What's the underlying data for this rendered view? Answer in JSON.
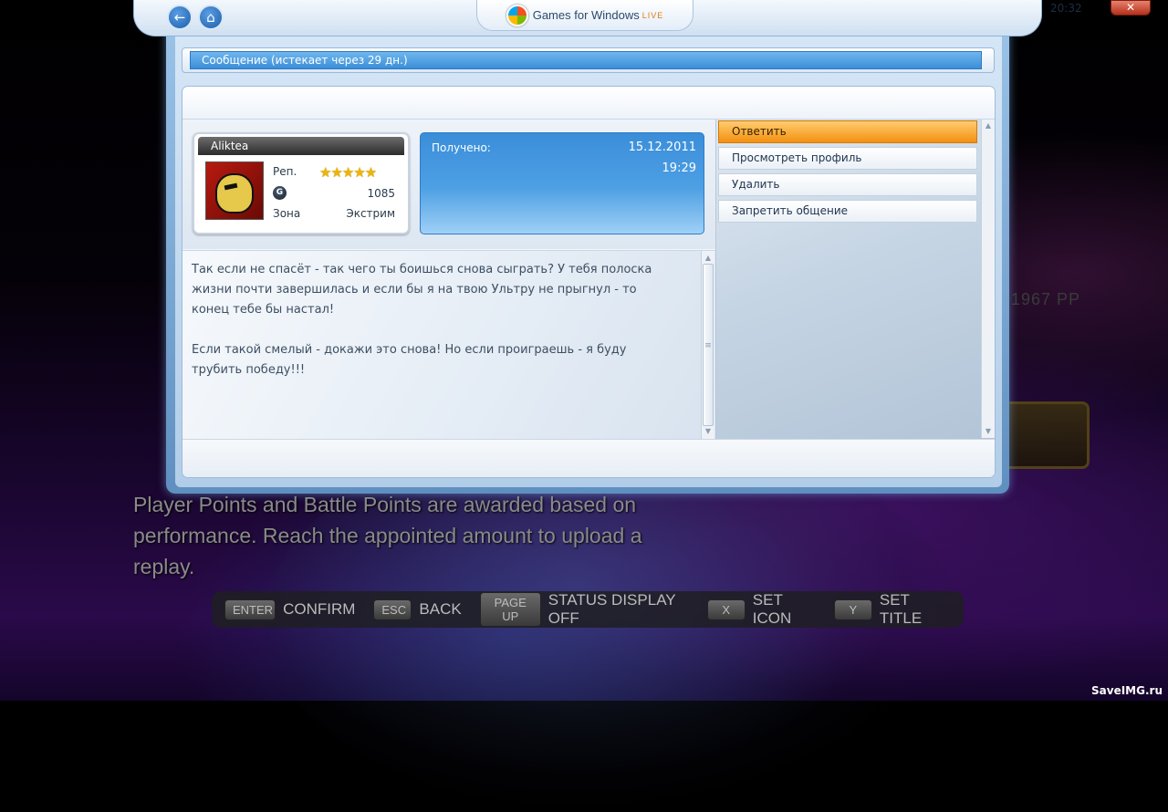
{
  "background": {
    "hint_text": "Player Points and Battle Points are awarded based on performance. Reach the appointed amount to upload a replay.",
    "partial_pp_text": "1967 PP",
    "controls": [
      {
        "key": "ENTER",
        "label": "CONFIRM"
      },
      {
        "key": "ESC",
        "label": "BACK"
      },
      {
        "key": "PAGE UP",
        "label": "STATUS DISPLAY OFF"
      },
      {
        "key": "X",
        "label": "SET ICON"
      },
      {
        "key": "Y",
        "label": "SET TITLE"
      }
    ],
    "watermark": "SaveIMG.ru"
  },
  "topbar": {
    "brand": "Games for Windows",
    "brand_live": "LIVE",
    "clock": "20:32",
    "close_glyph": "✕"
  },
  "dialog": {
    "title": "Сообщение (истекает через 29 дн.)",
    "gamercard": {
      "gamertag": "Aliktea",
      "rep_label": "Реп.",
      "stars": "★★★★★",
      "gamerscore_icon": "G",
      "gamerscore": "1085",
      "zone_label": "Зона",
      "zone_value": "Экстрим"
    },
    "received": {
      "label": "Получено:",
      "date": "15.12.2011",
      "time": "19:29"
    },
    "message": "Так если не спасёт - так чего ты боишься снова сыграть? У тебя полоска\nжизни почти завершилась и если бы я на твою Ультру не прыгнул - то\nконец тебе бы настал!\n\nЕсли такой смелый - докажи это снова! Но если проиграешь - я буду\nтрубить победу!!!",
    "actions": [
      {
        "label": "Ответить",
        "active": true
      },
      {
        "label": "Просмотреть профиль",
        "active": false
      },
      {
        "label": "Удалить",
        "active": false
      },
      {
        "label": "Запретить общение",
        "active": false
      }
    ]
  },
  "colors": {
    "accent_blue": "#3b8fd8",
    "active_orange": "#f39010"
  }
}
